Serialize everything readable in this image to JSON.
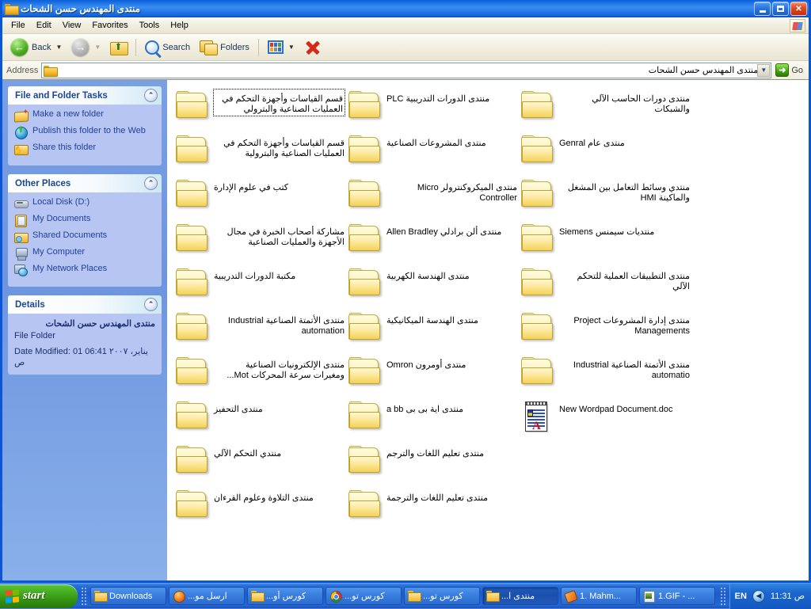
{
  "window": {
    "title": "منتدى المهندس حسن الشحات",
    "minimize_label": "Minimize",
    "maximize_label": "Restore",
    "close_label": "Close"
  },
  "menubar": {
    "items": [
      {
        "label": "File"
      },
      {
        "label": "Edit"
      },
      {
        "label": "View"
      },
      {
        "label": "Favorites"
      },
      {
        "label": "Tools"
      },
      {
        "label": "Help"
      }
    ]
  },
  "toolbar": {
    "back_label": "Back",
    "search_label": "Search",
    "folders_label": "Folders"
  },
  "address": {
    "label": "Address",
    "value": "D:\\منتدى المهندس حسن الشحات",
    "go_label": "Go"
  },
  "sidebar": {
    "tasks_panel": {
      "title": "File and Folder Tasks",
      "items": [
        {
          "label": "Make a new folder",
          "icon": "new-folder-icon"
        },
        {
          "label": "Publish this folder to the Web",
          "icon": "publish-web-icon"
        },
        {
          "label": "Share this folder",
          "icon": "share-folder-icon"
        }
      ]
    },
    "places_panel": {
      "title": "Other Places",
      "items": [
        {
          "label": "Local Disk (D:)",
          "icon": "hard-disk-icon"
        },
        {
          "label": "My Documents",
          "icon": "my-documents-icon"
        },
        {
          "label": "Shared Documents",
          "icon": "shared-documents-icon"
        },
        {
          "label": "My Computer",
          "icon": "my-computer-icon"
        },
        {
          "label": "My Network Places",
          "icon": "network-places-icon"
        }
      ]
    },
    "details_panel": {
      "title": "Details",
      "name": "منتدى المهندس حسن الشحات",
      "type": "File Folder",
      "modified": "Date Modified: 01 يناير، ٢٠٠٧ 06:41 ص"
    }
  },
  "content": {
    "items": [
      {
        "name": "قسم القياسات وأجهزة التحكم في العمليات الصناعية والبترولي",
        "type": "folder",
        "selected": true
      },
      {
        "name": "قسم القياسات وأجهزة التحكم في العمليات الصناعية والبترولية",
        "type": "folder",
        "selected": false
      },
      {
        "name": "كتب في علوم الإدارة",
        "type": "folder",
        "selected": false
      },
      {
        "name": "مشاركة أصحاب الخبرة في مجال الأجهزة والعمليات الصناعية",
        "type": "folder",
        "selected": false
      },
      {
        "name": "مكتبة الدورات التدريبية",
        "type": "folder",
        "selected": false
      },
      {
        "name": "منتدى الأتمتة الصناعية Industrial automation",
        "type": "folder",
        "selected": false
      },
      {
        "name": "منتدى الإلكترونيات الصناعية ومغيرات سرعة المحركات Mot...",
        "type": "folder",
        "selected": false
      },
      {
        "name": "منتدى التحفيز",
        "type": "folder",
        "selected": false
      },
      {
        "name": "منتدي التحكم الآلي",
        "type": "folder",
        "selected": false
      },
      {
        "name": "منتدى التلاوة وعلوم القرءان",
        "type": "folder",
        "selected": false
      },
      {
        "name": "منتدى الدورات التدريبية PLC",
        "type": "folder",
        "selected": false
      },
      {
        "name": "منتدى المشروعات الصناعية",
        "type": "folder",
        "selected": false
      },
      {
        "name": "منتدى الميكروكنترولر Micro Controller",
        "type": "folder",
        "selected": false
      },
      {
        "name": "منتدى ألن برادلي Allen Bradley",
        "type": "folder",
        "selected": false
      },
      {
        "name": "منتدى الهندسة الكهربية",
        "type": "folder",
        "selected": false
      },
      {
        "name": "منتدى الهندسة الميكانيكية",
        "type": "folder",
        "selected": false
      },
      {
        "name": "منتدى أومرون Omron",
        "type": "folder",
        "selected": false
      },
      {
        "name": "منتدى اية بى بى a bb",
        "type": "folder",
        "selected": false
      },
      {
        "name": "منتدى تعليم اللغات والترجم",
        "type": "folder",
        "selected": false
      },
      {
        "name": "منتدى تعليم اللغات والترجمة",
        "type": "folder",
        "selected": false
      },
      {
        "name": "منتدى دورات الحاسب الآلي والشبكات",
        "type": "folder",
        "selected": false
      },
      {
        "name": "منتدى عام Genral",
        "type": "folder",
        "selected": false
      },
      {
        "name": "منتدي وسائط التعامل بين المشغل والماكينة HMI",
        "type": "folder",
        "selected": false
      },
      {
        "name": "منتديات سيمنس Siemens",
        "type": "folder",
        "selected": false
      },
      {
        "name": "منتدى التطبيقات العملية للتحكم الآلي",
        "type": "folder",
        "selected": false
      },
      {
        "name": "منتدى إدارة المشروعات Project Managements",
        "type": "folder",
        "selected": false
      },
      {
        "name": "منتدى الأتمتة الصناعية Industrial automatio",
        "type": "folder",
        "selected": false
      },
      {
        "name": "New Wordpad Document.doc",
        "type": "file",
        "selected": false
      }
    ]
  },
  "taskbar": {
    "start_label": "start",
    "tasks": [
      {
        "label": "Downloads",
        "icon": "folder-icon",
        "active": false,
        "ltr": true
      },
      {
        "label": "ارسل مو...",
        "icon": "firefox-icon",
        "active": false,
        "ltr": false
      },
      {
        "label": "كورس أو...",
        "icon": "folder-icon",
        "active": false,
        "ltr": false
      },
      {
        "label": "كورس تو...",
        "icon": "chrome-icon",
        "active": false,
        "ltr": false
      },
      {
        "label": "كورس تو...",
        "icon": "folder-icon",
        "active": false,
        "ltr": false
      },
      {
        "label": "منتدى ا...",
        "icon": "folder-icon",
        "active": true,
        "ltr": false
      },
      {
        "label": "1. Mahm...",
        "icon": "paint-icon",
        "active": false,
        "ltr": true
      },
      {
        "label": "1.GIF - ...",
        "icon": "image-icon",
        "active": false,
        "ltr": true
      }
    ],
    "language": "EN",
    "clock": "11:31 ص"
  }
}
